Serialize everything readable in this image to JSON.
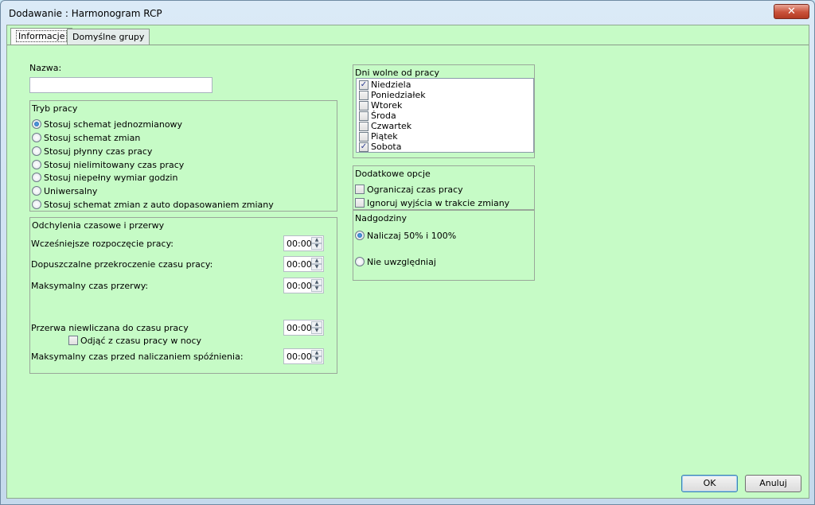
{
  "window": {
    "title": "Dodawanie : Harmonogram RCP",
    "close_label": "✕"
  },
  "tabs": [
    {
      "label": "Informacje",
      "active": true
    },
    {
      "label": "Domyślne grupy",
      "active": false
    }
  ],
  "name_field": {
    "label": "Nazwa:",
    "value": ""
  },
  "work_mode": {
    "title": "Tryb pracy",
    "options": [
      {
        "label": "Stosuj schemat jednozmianowy",
        "checked": true
      },
      {
        "label": "Stosuj schemat zmian",
        "checked": false
      },
      {
        "label": "Stosuj płynny czas pracy",
        "checked": false
      },
      {
        "label": "Stosuj nielimitowany czas pracy",
        "checked": false
      },
      {
        "label": "Stosuj niepełny wymiar godzin",
        "checked": false
      },
      {
        "label": "Uniwersalny",
        "checked": false
      },
      {
        "label": "Stosuj schemat zmian z auto dopasowaniem zmiany",
        "checked": false
      }
    ]
  },
  "deviations": {
    "title": "Odchylenia czasowe i przerwy",
    "rows": [
      {
        "label": "Wcześniejsze rozpoczęcie pracy:",
        "value": "00:00"
      },
      {
        "label": "Dopuszczalne przekroczenie czasu pracy:",
        "value": "00:00"
      },
      {
        "label": "Maksymalny czas przerwy:",
        "value": "00:00"
      },
      {
        "label": "Przerwa niewliczana do czasu pracy",
        "value": "00:00"
      },
      {
        "label": "Maksymalny czas przed naliczaniem spóźnienia:",
        "value": "00:00"
      }
    ],
    "night_checkbox": {
      "label": "Odjąć z czasu pracy w nocy",
      "checked": false
    }
  },
  "days_off": {
    "title": "Dni wolne od pracy",
    "days": [
      {
        "label": "Niedziela",
        "checked": true
      },
      {
        "label": "Poniedziałek",
        "checked": false
      },
      {
        "label": "Wtorek",
        "checked": false
      },
      {
        "label": "Środa",
        "checked": false
      },
      {
        "label": "Czwartek",
        "checked": false
      },
      {
        "label": "Piątek",
        "checked": false
      },
      {
        "label": "Sobota",
        "checked": true
      }
    ]
  },
  "extra_options": {
    "title": "Dodatkowe opcje",
    "options": [
      {
        "label": "Ograniczaj czas pracy",
        "checked": false
      },
      {
        "label": "Ignoruj wyjścia w trakcie zmiany",
        "checked": false
      }
    ]
  },
  "overtime": {
    "title": "Nadgodziny",
    "options": [
      {
        "label": "Naliczaj 50% i 100%",
        "checked": true
      },
      {
        "label": "Nie uwzględniaj",
        "checked": false
      }
    ]
  },
  "buttons": {
    "ok": "OK",
    "cancel": "Anuluj"
  },
  "colors": {
    "background": "#c6fbc6",
    "close": "#c9513a"
  }
}
